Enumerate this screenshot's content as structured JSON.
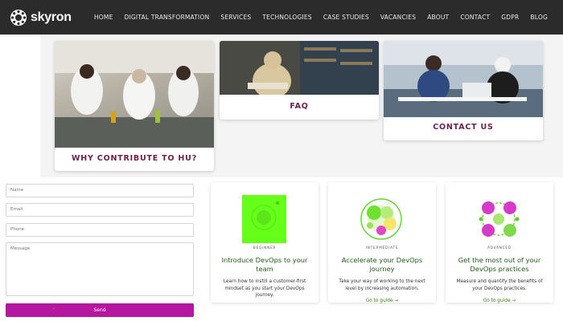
{
  "header": {
    "brand": "skyron",
    "nav": [
      "HOME",
      "DIGITAL TRANSFORMATION",
      "SERVICES",
      "TECHNOLOGIES",
      "CASE STUDIES",
      "VACANCIES",
      "ABOUT",
      "CONTACT",
      "GDPR",
      "BLOG"
    ]
  },
  "feature_cards": [
    {
      "caption": "WHY CONTRIBUTE TO HU?",
      "image": "laboratory-students-photo"
    },
    {
      "caption": "FAQ",
      "image": "library-student-photo"
    },
    {
      "caption": "CONTACT US",
      "image": "students-at-laptop-photo"
    }
  ],
  "form": {
    "name_placeholder": "Name",
    "email_placeholder": "Email",
    "phone_placeholder": "Phone",
    "message_placeholder": "Message",
    "send_label": "Send"
  },
  "guides": [
    {
      "level": "BEGINNER",
      "title": "Introduce DevOps to your team",
      "description": "Learn how to instill a customer-first mindset as you start your DevOps journey.",
      "link": "",
      "icon": "beginner-graphic"
    },
    {
      "level": "INTERMEDIATE",
      "title": "Accelerate your DevOps journey",
      "description": "Take your way of working to the next level by increasing automation.",
      "link": "Go to guide →",
      "icon": "intermediate-graphic"
    },
    {
      "level": "ADVANCED",
      "title": "Get the most out of your DevOps practices",
      "description": "Measure and quantify the benefits of your DevOps practices.",
      "link": "Go to guide →",
      "icon": "advanced-graphic"
    }
  ],
  "colors": {
    "accent": "#b5179e",
    "caption": "#6b1f4a",
    "guide_title": "#1f5c16",
    "topbar": "#2b2b2b"
  }
}
